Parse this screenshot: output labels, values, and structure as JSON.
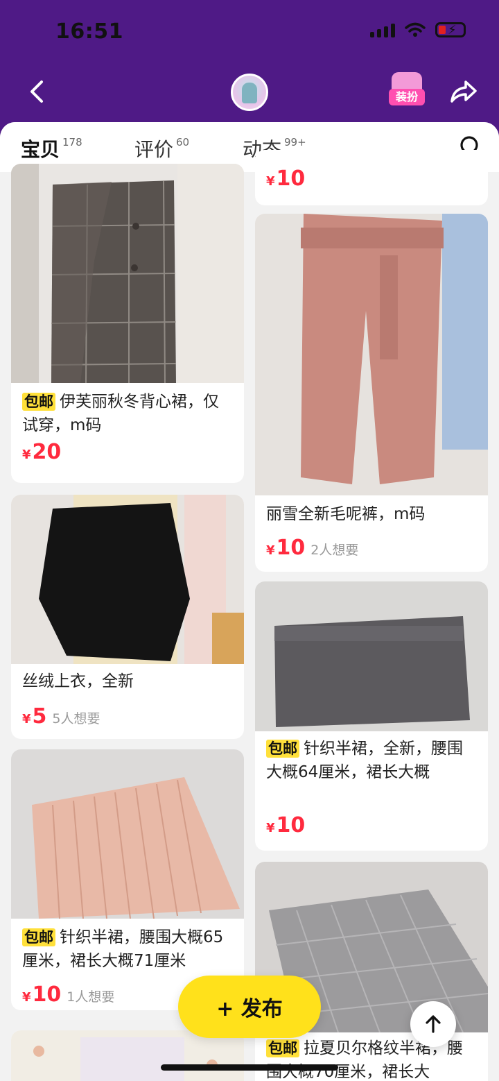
{
  "status_bar": {
    "time": "16:51"
  },
  "nav": {
    "badge_label": "装扮"
  },
  "tabs": [
    {
      "label": "宝贝",
      "count": "178"
    },
    {
      "label": "评价",
      "count": "60"
    },
    {
      "label": "动态",
      "count": "99+"
    }
  ],
  "items": [
    {
      "title": "伊芙丽秋冬背心裙，仅试穿，m码",
      "badge": "包邮",
      "yen": "¥",
      "price": "20",
      "want": ""
    },
    {
      "title": "丝绒上衣，全新",
      "badge": "",
      "yen": "¥",
      "price": "5",
      "want": "5人想要"
    },
    {
      "title": "针织半裙，腰围大概65厘米，裙长大概71厘米",
      "badge": "包邮",
      "yen": "¥",
      "price": "10",
      "want": "1人想要"
    },
    {
      "title": "",
      "badge": "",
      "yen": "¥",
      "price": "10",
      "want": ""
    },
    {
      "title": "丽雪全新毛呢裤，m码",
      "badge": "",
      "yen": "¥",
      "price": "10",
      "want": "2人想要"
    },
    {
      "title": "针织半裙，全新，腰围大概64厘米，裙长大概",
      "badge": "包邮",
      "yen": "¥",
      "price": "10",
      "want": ""
    },
    {
      "title": "拉夏贝尔格纹半裙，腰围大概70厘米，裙长大",
      "badge": "包邮",
      "yen": "",
      "price": "",
      "want": ""
    }
  ],
  "fab": {
    "publish_label": "+ 发布"
  },
  "colors": {
    "header": "#4f1a86",
    "accent": "#ffe03a",
    "price": "#ff2a3e"
  }
}
